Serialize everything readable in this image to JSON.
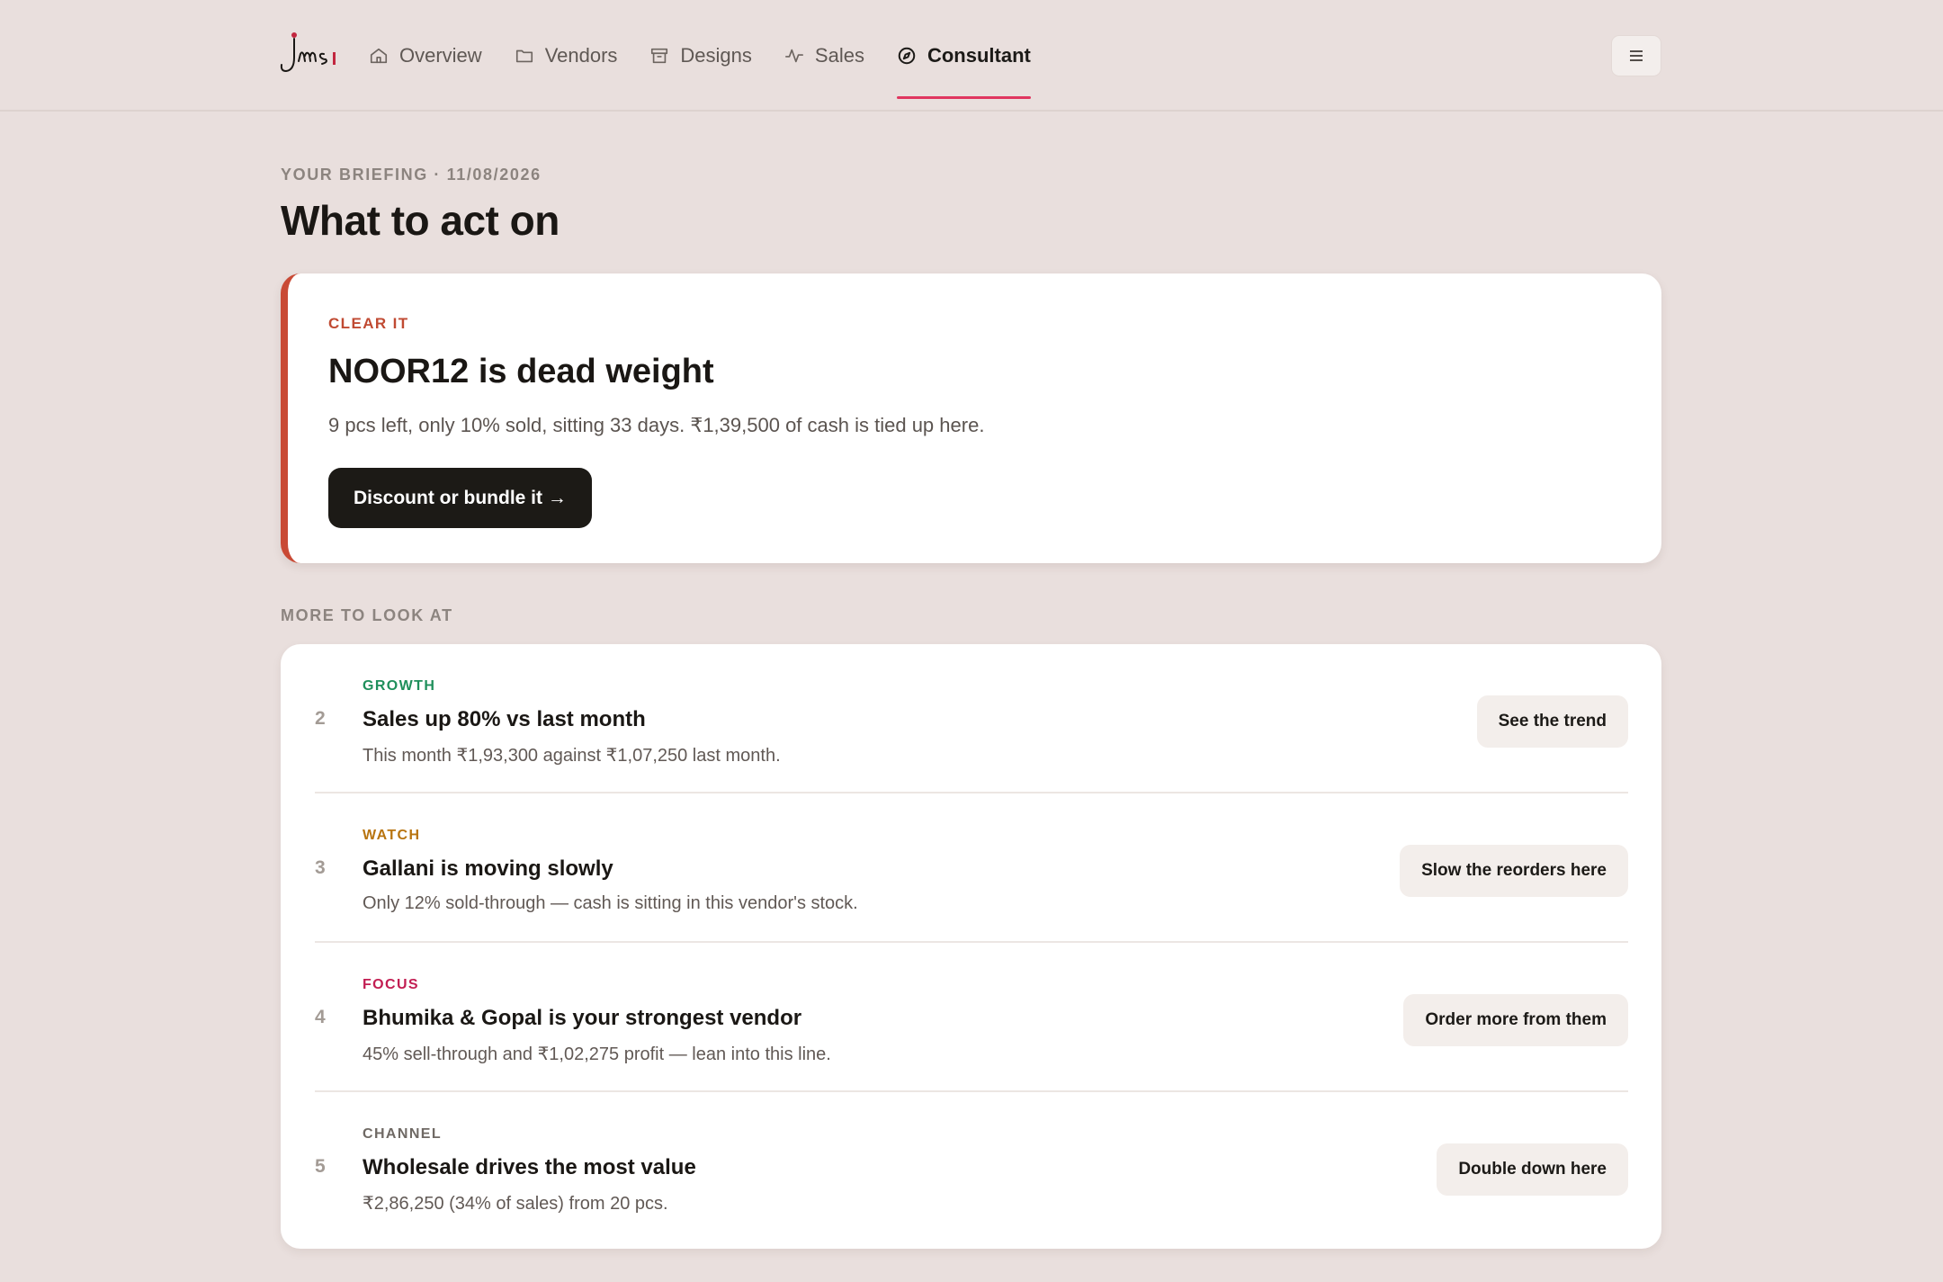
{
  "colors": {
    "accent": "#e0365f",
    "clear": "#c04a32",
    "growth": "#1f8f5b",
    "watch": "#b8740f",
    "focus": "#c21d52",
    "channel": "#6f6964"
  },
  "nav": {
    "items": [
      {
        "label": "Overview",
        "icon": "home-icon"
      },
      {
        "label": "Vendors",
        "icon": "folder-icon"
      },
      {
        "label": "Designs",
        "icon": "archive-icon"
      },
      {
        "label": "Sales",
        "icon": "activity-icon"
      },
      {
        "label": "Consultant",
        "icon": "compass-icon",
        "active": true
      }
    ],
    "menu_icon": "hamburger-icon"
  },
  "briefing": {
    "kicker": "YOUR BRIEFING · 11/08/2026",
    "title": "What to act on"
  },
  "hero": {
    "tag": "CLEAR IT",
    "title": "NOOR12 is dead weight",
    "description": "9 pcs left, only 10% sold, sitting 33 days. ₹1,39,500 of cash is tied up here.",
    "button": "Discount or bundle it →"
  },
  "more": {
    "label": "MORE TO LOOK AT",
    "items": [
      {
        "num": "2",
        "tag": "GROWTH",
        "title": "Sales up 80% vs last month",
        "description": "This month ₹1,93,300 against ₹1,07,250 last month.",
        "button": "See the trend"
      },
      {
        "num": "3",
        "tag": "WATCH",
        "title": "Gallani is moving slowly",
        "description": "Only 12% sold-through — cash is sitting in this vendor's stock.",
        "button": "Slow the reorders here"
      },
      {
        "num": "4",
        "tag": "FOCUS",
        "title": "Bhumika & Gopal is your strongest vendor",
        "description": "45% sell-through and ₹1,02,275 profit — lean into this line.",
        "button": "Order more from them"
      },
      {
        "num": "5",
        "tag": "CHANNEL",
        "title": "Wholesale drives the most value",
        "description": "₹2,86,250 (34% of sales) from 20 pcs.",
        "button": "Double down here"
      }
    ]
  }
}
